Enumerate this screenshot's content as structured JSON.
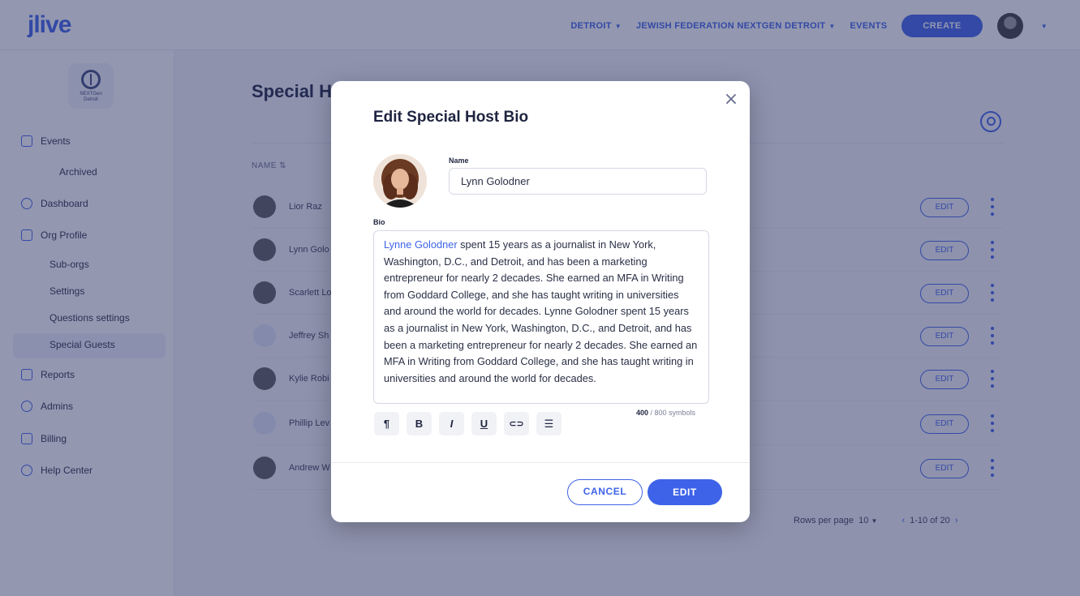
{
  "brand": {
    "logo": "jlive",
    "accent_color": "#3e63e8"
  },
  "topnav": {
    "city": "DETROIT",
    "org": "JEWISH FEDERATION NEXTGEN DETROIT",
    "events": "EVENTS",
    "create": "CREATE"
  },
  "sidebar": {
    "org_logo_text": "NEXTGen Detroit",
    "items": [
      {
        "label": "Events",
        "icon": "calendar-icon"
      },
      {
        "label": "Archived"
      },
      {
        "label": "Dashboard",
        "icon": "gauge-icon"
      },
      {
        "label": "Org Profile",
        "icon": "profile-icon"
      },
      {
        "label": "Sub-orgs"
      },
      {
        "label": "Settings"
      },
      {
        "label": "Questions settings"
      },
      {
        "label": "Special Guests"
      },
      {
        "label": "Reports",
        "icon": "reports-icon"
      },
      {
        "label": "Admins",
        "icon": "admin-icon"
      },
      {
        "label": "Billing",
        "icon": "billing-icon"
      },
      {
        "label": "Help Center",
        "icon": "info-icon"
      }
    ]
  },
  "main": {
    "title": "Special Ho",
    "column_name": "NAME",
    "edit_label": "EDIT",
    "rows": [
      {
        "name": "Lior Raz"
      },
      {
        "name": "Lynn Golo"
      },
      {
        "name": "Scarlett Lo"
      },
      {
        "name": "Jeffrey Sh"
      },
      {
        "name": "Kylie Robi"
      },
      {
        "name": "Phillip Lev"
      },
      {
        "name": "Andrew W"
      }
    ],
    "pager": {
      "rows_per_page": "Rows per page",
      "rows_value": "10",
      "range": "1-10 of 20"
    }
  },
  "modal": {
    "title": "Edit Special Host Bio",
    "close": "×",
    "name_label": "Name",
    "name_value": "Lynn Golodner",
    "bio_label": "Bio",
    "bio_link": "Lynne Golodner",
    "bio_text": " spent 15 years as a journalist in New York, Washington, D.C., and Detroit, and has been a marketing entrepreneur for nearly 2 decades. She earned an MFA in Writing from Goddard College, and she has taught writing in universities and around the world for decades. Lynne Golodner spent 15 years as a journalist in New York, Washington, D.C., and Detroit, and has been a marketing entrepreneur for nearly 2 decades. She earned an MFA in Writing from Goddard College, and she has taught writing in universities and around the world for decades.",
    "toolbar": {
      "paragraph": "¶",
      "bold": "B",
      "italic": "I",
      "underline": "U",
      "link": "⊂⊃",
      "list": "☰"
    },
    "counter_value": "400",
    "counter_rest": " / 800 symbols",
    "cancel": "CANCEL",
    "edit": "EDIT"
  }
}
